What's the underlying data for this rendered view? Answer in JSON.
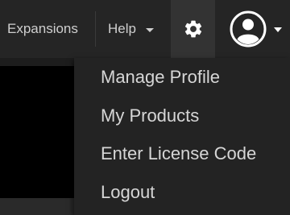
{
  "navbar": {
    "expansions_label": "Expansions",
    "help_label": "Help",
    "settings_icon": "gear-icon",
    "profile_icon": "user-avatar-icon"
  },
  "profile_menu": {
    "items": [
      {
        "label": "Manage Profile"
      },
      {
        "label": "My Products"
      },
      {
        "label": "Enter License Code"
      },
      {
        "label": "Logout"
      }
    ]
  },
  "colors": {
    "navbar_bg": "#252525",
    "active_button_bg": "#333333",
    "menu_bg": "#232323",
    "text": "#d6d6d6"
  }
}
